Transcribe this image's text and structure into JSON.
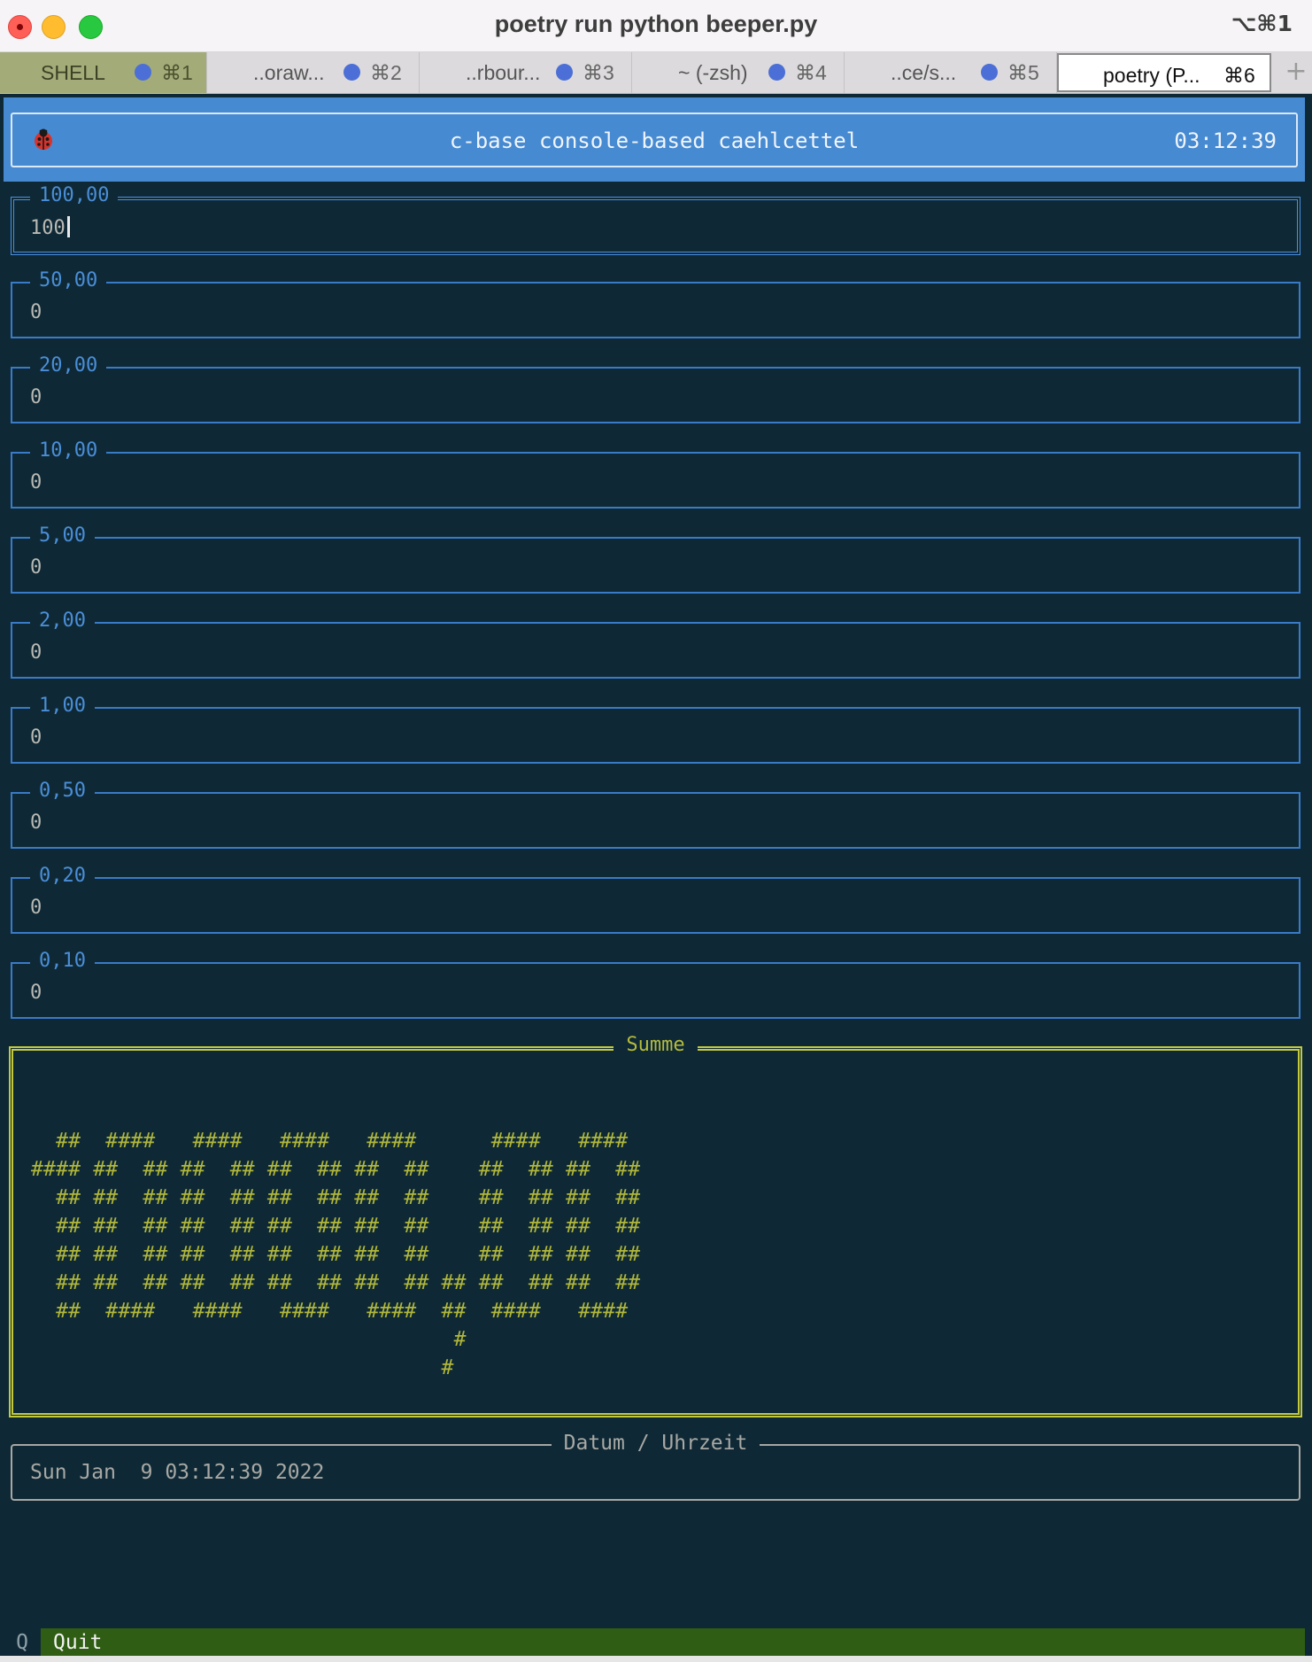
{
  "window": {
    "title": "poetry run python beeper.py",
    "shortcut": "⌥⌘1"
  },
  "tabs": [
    {
      "label": "SHELL",
      "key": "⌘1",
      "active": false
    },
    {
      "label": "..oraw...",
      "key": "⌘2",
      "active": false
    },
    {
      "label": "..rbour...",
      "key": "⌘3",
      "active": false
    },
    {
      "label": "~ (-zsh)",
      "key": "⌘4",
      "active": false
    },
    {
      "label": "..ce/s...",
      "key": "⌘5",
      "active": false
    },
    {
      "label": "poetry (P...",
      "key": "⌘6",
      "active": true
    }
  ],
  "tab_add_icon": "+",
  "header": {
    "icon": "ladybug-icon",
    "title": "c-base console-based caehlcettel",
    "clock": "03:12:39"
  },
  "denominations": [
    {
      "label": "100,00",
      "value": "100"
    },
    {
      "label": "50,00",
      "value": "0"
    },
    {
      "label": "20,00",
      "value": "0"
    },
    {
      "label": "10,00",
      "value": "0"
    },
    {
      "label": "5,00",
      "value": "0"
    },
    {
      "label": "2,00",
      "value": "0"
    },
    {
      "label": "1,00",
      "value": "0"
    },
    {
      "label": "0,50",
      "value": "0"
    },
    {
      "label": "0,20",
      "value": "0"
    },
    {
      "label": "0,10",
      "value": "0"
    }
  ],
  "summe": {
    "title": "Summe",
    "ascii_art": "  ##  ####   ####   ####   ####      ####   ####\n#### ##  ## ##  ## ##  ## ##  ##    ##  ## ##  ##\n  ## ##  ## ##  ## ##  ## ##  ##    ##  ## ##  ##\n  ## ##  ## ##  ## ##  ## ##  ##    ##  ## ##  ##\n  ## ##  ## ##  ## ##  ## ##  ##    ##  ## ##  ##\n  ## ##  ## ##  ## ##  ## ##  ## ## ##  ## ##  ##\n  ##  ####   ####   ####   ####  ##  ####   ####\n                                  #\n                                 #"
  },
  "datetime": {
    "title": "Datum / Uhrzeit",
    "value": "Sun Jan  9 03:12:39 2022"
  },
  "footer": {
    "key": "Q",
    "label": "Quit"
  },
  "colors": {
    "background": "#0e2935",
    "header_blue": "#468ad2",
    "field_border": "#3a7bc8",
    "summe_yellow": "#b5bb3c",
    "footer_green": "#2f5d13"
  }
}
